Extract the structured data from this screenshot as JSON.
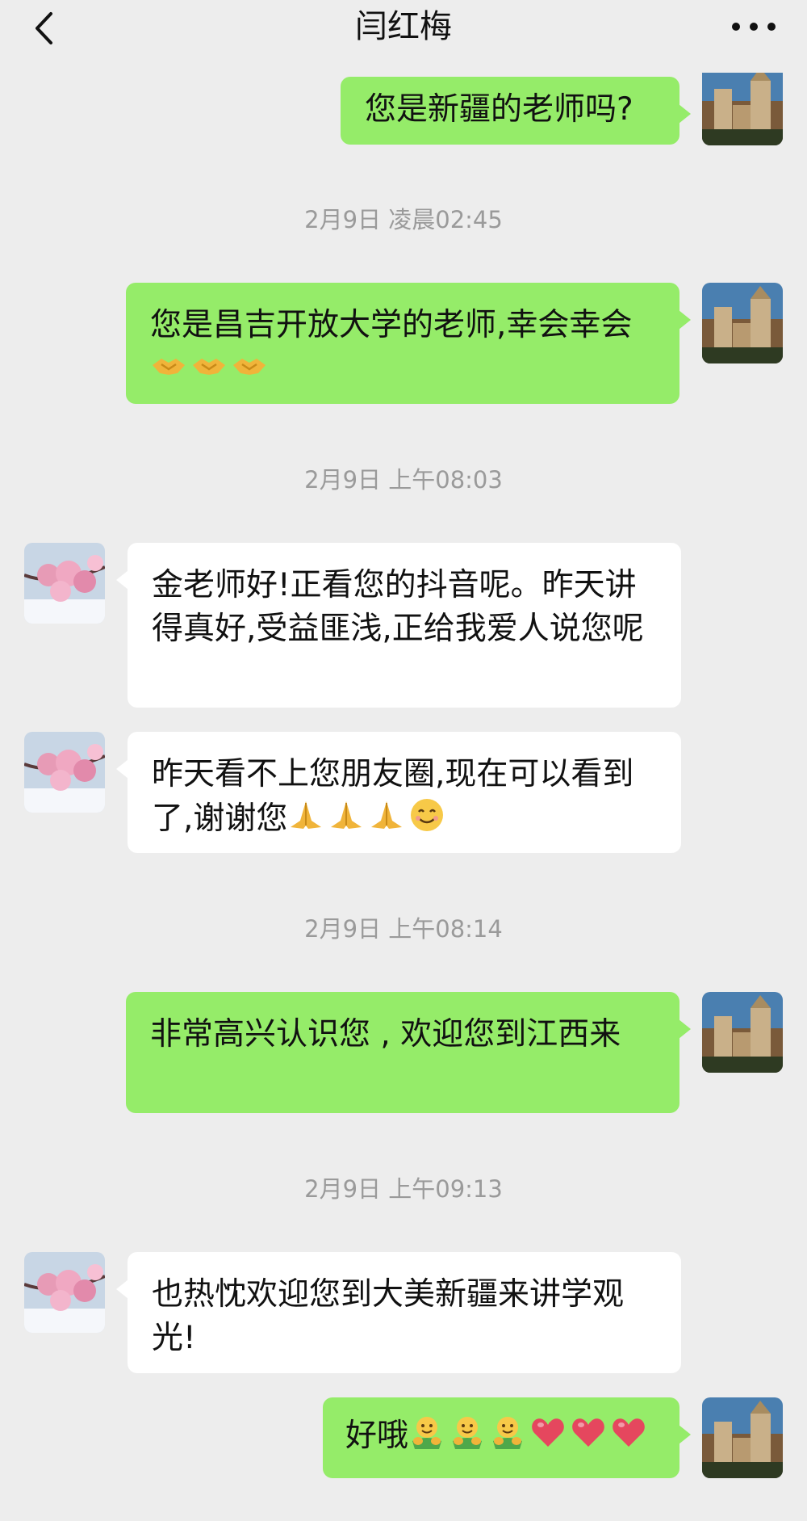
{
  "header": {
    "title": "闫红梅",
    "back_icon": "chevron-left-icon",
    "more_icon": "more-dots-icon"
  },
  "colors": {
    "bg": "#ededed",
    "my_bubble": "#95ec69",
    "other_bubble": "#ffffff",
    "timestamp": "#9a9a9a"
  },
  "messages": [
    {
      "from": "me",
      "text": "您是新疆的老师吗?"
    },
    {
      "type": "time",
      "text": "2月9日 凌晨02:45"
    },
    {
      "from": "me",
      "text": "您是昌吉开放大学的老师,幸会幸会",
      "emojis": [
        "handshake",
        "handshake",
        "handshake"
      ]
    },
    {
      "type": "time",
      "text": "2月9日 上午08:03"
    },
    {
      "from": "other",
      "text": "金老师好!正看您的抖音呢。昨天讲得真好,受益匪浅,正给我爱人说您呢"
    },
    {
      "from": "other",
      "text": "昨天看不上您朋友圈,现在可以看到了,谢谢您",
      "emojis": [
        "pray",
        "pray",
        "pray",
        "smile"
      ]
    },
    {
      "type": "time",
      "text": "2月9日 上午08:14"
    },
    {
      "from": "me",
      "text": "非常高兴认识您 , 欢迎您到江西来"
    },
    {
      "type": "time",
      "text": "2月9日 上午09:13"
    },
    {
      "from": "other",
      "text": "也热忱欢迎您到大美新疆来讲学观光!"
    },
    {
      "from": "me",
      "text": "好哦",
      "emojis": [
        "hug",
        "hug",
        "hug",
        "heart",
        "heart",
        "heart"
      ]
    }
  ]
}
